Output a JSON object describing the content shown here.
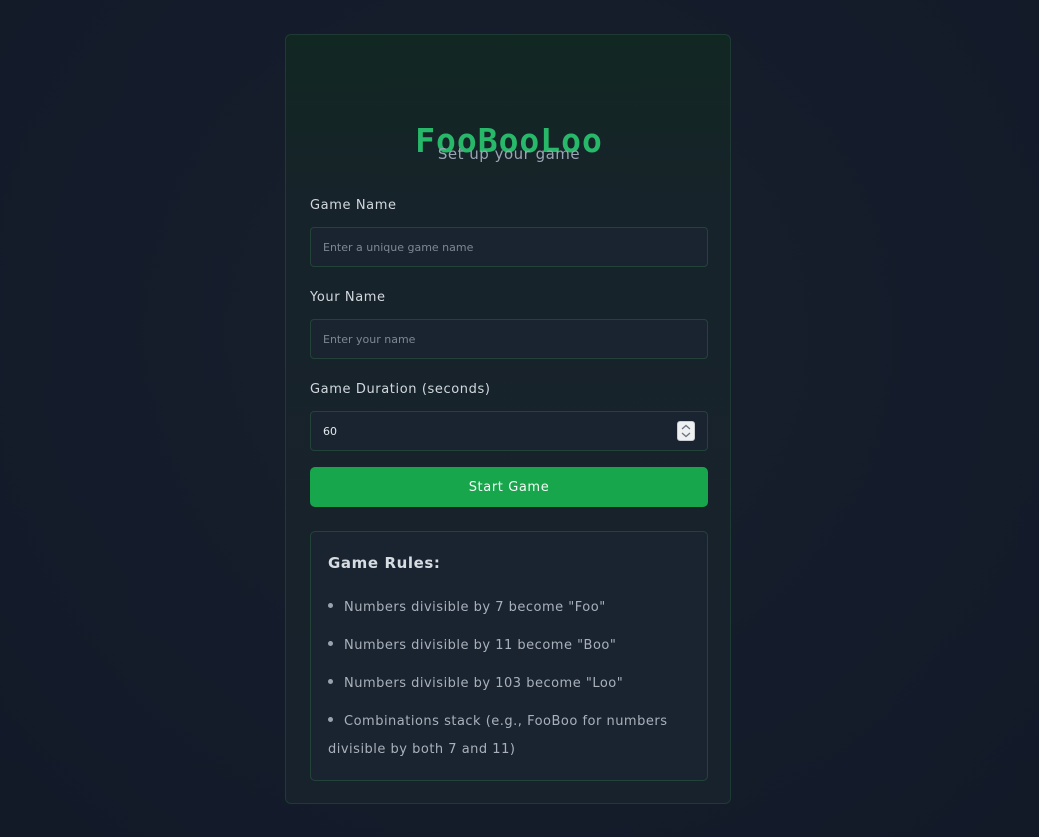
{
  "app": {
    "title": "FooBooLoo",
    "subtitle": "Set up your game"
  },
  "form": {
    "game_name": {
      "label": "Game Name",
      "placeholder": "Enter a unique game name",
      "value": ""
    },
    "your_name": {
      "label": "Your Name",
      "placeholder": "Enter your name",
      "value": ""
    },
    "duration": {
      "label": "Game Duration (seconds)",
      "value": "60"
    },
    "start_label": "Start Game"
  },
  "rules": {
    "title": "Game Rules:",
    "items": [
      "Numbers divisible by 7 become \"Foo\"",
      "Numbers divisible by 11 become \"Boo\"",
      "Numbers divisible by 103 become \"Loo\"",
      "Combinations stack (e.g., FooBoo for numbers divisible by both 7 and 11)"
    ]
  },
  "colors": {
    "accent": "#27b86a",
    "button": "#18a64c",
    "background": "#141c2b",
    "card_border": "#1f3a34"
  },
  "icons": {
    "stepper": "chevron-up-down-icon",
    "bullet": "bullet-dot-icon"
  }
}
